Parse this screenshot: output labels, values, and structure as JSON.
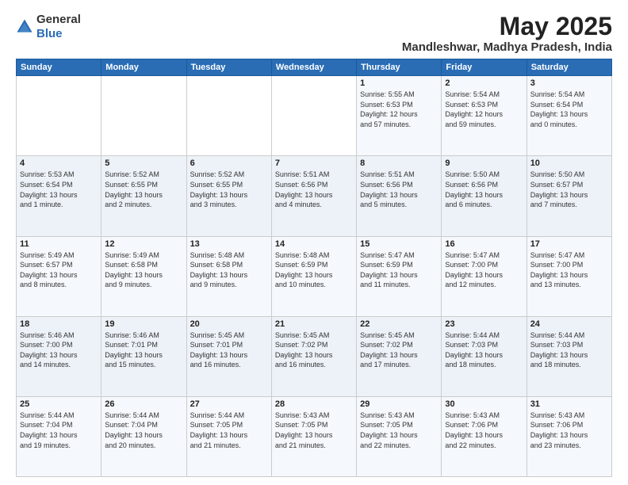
{
  "header": {
    "logo_general": "General",
    "logo_blue": "Blue",
    "title": "May 2025",
    "subtitle": "Mandleshwar, Madhya Pradesh, India"
  },
  "calendar": {
    "headers": [
      "Sunday",
      "Monday",
      "Tuesday",
      "Wednesday",
      "Thursday",
      "Friday",
      "Saturday"
    ],
    "weeks": [
      [
        {
          "day": "",
          "info": ""
        },
        {
          "day": "",
          "info": ""
        },
        {
          "day": "",
          "info": ""
        },
        {
          "day": "",
          "info": ""
        },
        {
          "day": "1",
          "info": "Sunrise: 5:55 AM\nSunset: 6:53 PM\nDaylight: 12 hours\nand 57 minutes."
        },
        {
          "day": "2",
          "info": "Sunrise: 5:54 AM\nSunset: 6:53 PM\nDaylight: 12 hours\nand 59 minutes."
        },
        {
          "day": "3",
          "info": "Sunrise: 5:54 AM\nSunset: 6:54 PM\nDaylight: 13 hours\nand 0 minutes."
        }
      ],
      [
        {
          "day": "4",
          "info": "Sunrise: 5:53 AM\nSunset: 6:54 PM\nDaylight: 13 hours\nand 1 minute."
        },
        {
          "day": "5",
          "info": "Sunrise: 5:52 AM\nSunset: 6:55 PM\nDaylight: 13 hours\nand 2 minutes."
        },
        {
          "day": "6",
          "info": "Sunrise: 5:52 AM\nSunset: 6:55 PM\nDaylight: 13 hours\nand 3 minutes."
        },
        {
          "day": "7",
          "info": "Sunrise: 5:51 AM\nSunset: 6:56 PM\nDaylight: 13 hours\nand 4 minutes."
        },
        {
          "day": "8",
          "info": "Sunrise: 5:51 AM\nSunset: 6:56 PM\nDaylight: 13 hours\nand 5 minutes."
        },
        {
          "day": "9",
          "info": "Sunrise: 5:50 AM\nSunset: 6:56 PM\nDaylight: 13 hours\nand 6 minutes."
        },
        {
          "day": "10",
          "info": "Sunrise: 5:50 AM\nSunset: 6:57 PM\nDaylight: 13 hours\nand 7 minutes."
        }
      ],
      [
        {
          "day": "11",
          "info": "Sunrise: 5:49 AM\nSunset: 6:57 PM\nDaylight: 13 hours\nand 8 minutes."
        },
        {
          "day": "12",
          "info": "Sunrise: 5:49 AM\nSunset: 6:58 PM\nDaylight: 13 hours\nand 9 minutes."
        },
        {
          "day": "13",
          "info": "Sunrise: 5:48 AM\nSunset: 6:58 PM\nDaylight: 13 hours\nand 9 minutes."
        },
        {
          "day": "14",
          "info": "Sunrise: 5:48 AM\nSunset: 6:59 PM\nDaylight: 13 hours\nand 10 minutes."
        },
        {
          "day": "15",
          "info": "Sunrise: 5:47 AM\nSunset: 6:59 PM\nDaylight: 13 hours\nand 11 minutes."
        },
        {
          "day": "16",
          "info": "Sunrise: 5:47 AM\nSunset: 7:00 PM\nDaylight: 13 hours\nand 12 minutes."
        },
        {
          "day": "17",
          "info": "Sunrise: 5:47 AM\nSunset: 7:00 PM\nDaylight: 13 hours\nand 13 minutes."
        }
      ],
      [
        {
          "day": "18",
          "info": "Sunrise: 5:46 AM\nSunset: 7:00 PM\nDaylight: 13 hours\nand 14 minutes."
        },
        {
          "day": "19",
          "info": "Sunrise: 5:46 AM\nSunset: 7:01 PM\nDaylight: 13 hours\nand 15 minutes."
        },
        {
          "day": "20",
          "info": "Sunrise: 5:45 AM\nSunset: 7:01 PM\nDaylight: 13 hours\nand 16 minutes."
        },
        {
          "day": "21",
          "info": "Sunrise: 5:45 AM\nSunset: 7:02 PM\nDaylight: 13 hours\nand 16 minutes."
        },
        {
          "day": "22",
          "info": "Sunrise: 5:45 AM\nSunset: 7:02 PM\nDaylight: 13 hours\nand 17 minutes."
        },
        {
          "day": "23",
          "info": "Sunrise: 5:44 AM\nSunset: 7:03 PM\nDaylight: 13 hours\nand 18 minutes."
        },
        {
          "day": "24",
          "info": "Sunrise: 5:44 AM\nSunset: 7:03 PM\nDaylight: 13 hours\nand 18 minutes."
        }
      ],
      [
        {
          "day": "25",
          "info": "Sunrise: 5:44 AM\nSunset: 7:04 PM\nDaylight: 13 hours\nand 19 minutes."
        },
        {
          "day": "26",
          "info": "Sunrise: 5:44 AM\nSunset: 7:04 PM\nDaylight: 13 hours\nand 20 minutes."
        },
        {
          "day": "27",
          "info": "Sunrise: 5:44 AM\nSunset: 7:05 PM\nDaylight: 13 hours\nand 21 minutes."
        },
        {
          "day": "28",
          "info": "Sunrise: 5:43 AM\nSunset: 7:05 PM\nDaylight: 13 hours\nand 21 minutes."
        },
        {
          "day": "29",
          "info": "Sunrise: 5:43 AM\nSunset: 7:05 PM\nDaylight: 13 hours\nand 22 minutes."
        },
        {
          "day": "30",
          "info": "Sunrise: 5:43 AM\nSunset: 7:06 PM\nDaylight: 13 hours\nand 22 minutes."
        },
        {
          "day": "31",
          "info": "Sunrise: 5:43 AM\nSunset: 7:06 PM\nDaylight: 13 hours\nand 23 minutes."
        }
      ]
    ]
  }
}
